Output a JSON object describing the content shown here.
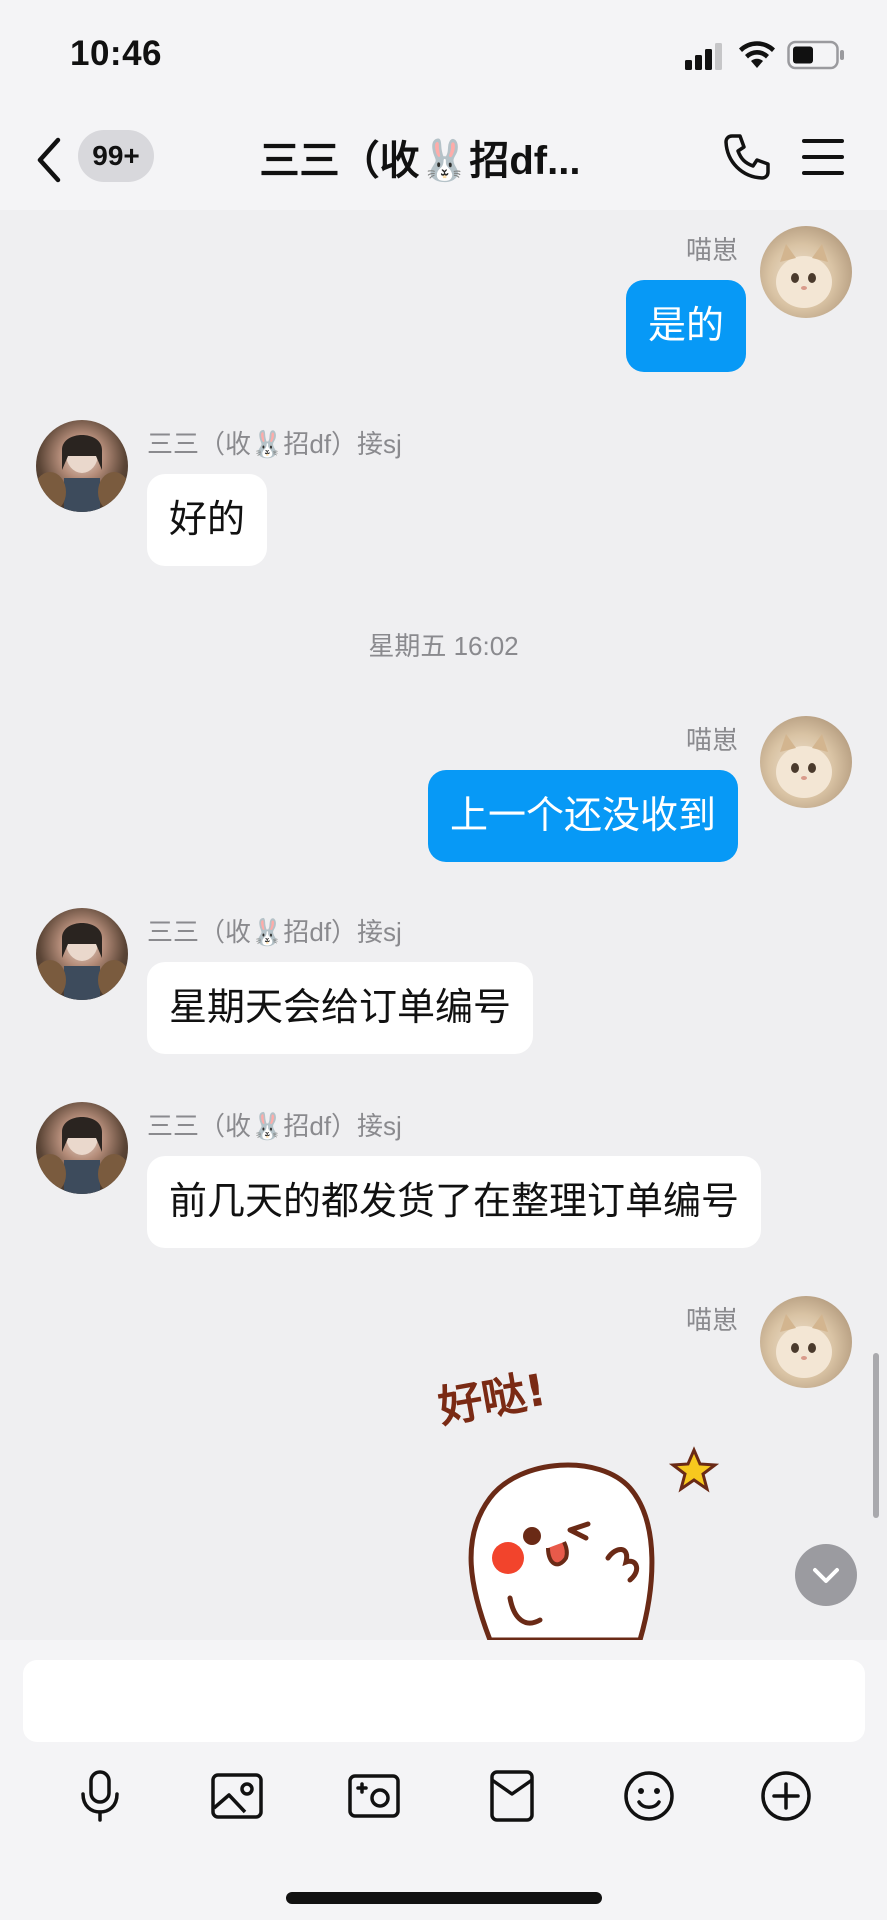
{
  "status_bar": {
    "time": "10:46"
  },
  "header": {
    "badge": "99+",
    "title": "三三（收🐰招df..."
  },
  "messages": [
    {
      "direction": "out",
      "sender": "喵崽",
      "text": "是的"
    },
    {
      "direction": "in",
      "sender": "三三（收🐰招df）接sj",
      "text": "好的"
    },
    {
      "type": "timestamp",
      "text": "星期五 16:02"
    },
    {
      "direction": "out",
      "sender": "喵崽",
      "text": "上一个还没收到"
    },
    {
      "direction": "in",
      "sender": "三三（收🐰招df）接sj",
      "text": "星期天会给订单编号"
    },
    {
      "direction": "in",
      "sender": "三三（收🐰招df）接sj",
      "text": "前几天的都发货了在整理订单编号"
    },
    {
      "direction": "out",
      "sender": "喵崽",
      "sticker_text": "好哒!"
    }
  ],
  "input": {
    "placeholder": ""
  },
  "toolbar_icons": [
    "microphone-icon",
    "image-icon",
    "camera-icon",
    "red-packet-icon",
    "emoji-icon",
    "plus-icon"
  ],
  "colors": {
    "outgoing_bubble": "#0799f6",
    "incoming_bubble": "#ffffff",
    "background": "#efeff1"
  }
}
